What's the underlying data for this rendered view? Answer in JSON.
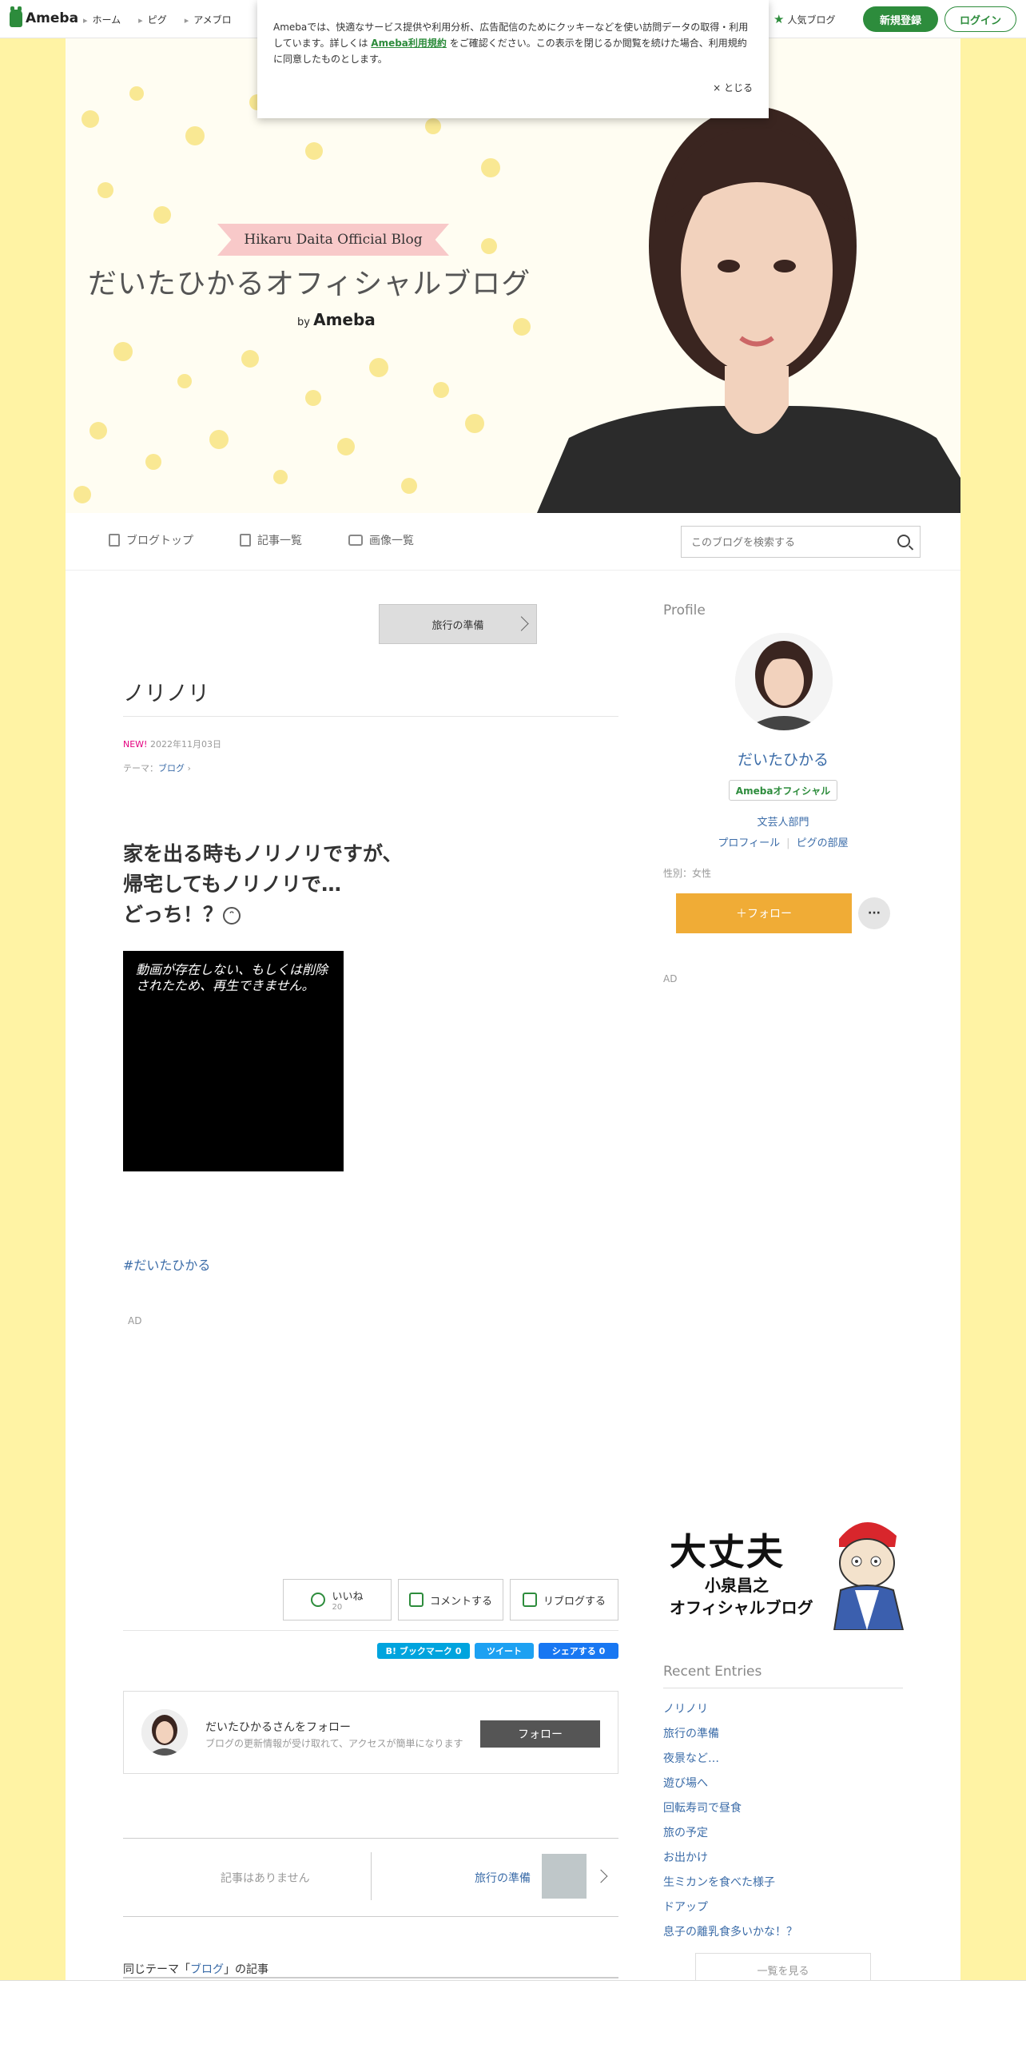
{
  "topbar": {
    "logo": "Ameba",
    "nav": [
      "ホーム",
      "ピグ",
      "アメブロ"
    ],
    "popular": "人気ブログ",
    "register": "新規登録",
    "login": "ログイン"
  },
  "cookie": {
    "text1": "Amebaでは、快適なサービス提供や利用分析、広告配信のためにクッキーなどを使い訪問データの取得・利用しています。詳しくは",
    "link": "Ameba利用規約",
    "text2": "をご確認ください。この表示を閉じるか閲覧を続けた場合、利用規約に同意したものとします。",
    "close": "× とじる"
  },
  "header": {
    "ribbon": "Hikaru Daita Official Blog",
    "title": "だいたひかるオフィシャルブログ",
    "by": "by",
    "ameba": "Ameba"
  },
  "blognav": {
    "items": [
      "ブログトップ",
      "記事一覧",
      "画像一覧"
    ],
    "search_placeholder": "このブログを検索する"
  },
  "article": {
    "prev_theme": "旅行の準備",
    "title": "ノリノリ",
    "new": "NEW!",
    "date": "2022年11月03日",
    "theme_label": "テーマ：",
    "theme": "ブログ",
    "lines": [
      "家を出る時もノリノリですが、",
      "帰宅してもノリノリで…",
      "どっち！？"
    ],
    "video_msg": "動画が存在しない、もしくは削除されたため、再生できません。",
    "hashtag": "#だいたひかる",
    "ad": "AD",
    "like": "いいね",
    "like_count": "20",
    "comment": "コメントする",
    "reblog": "リブログする",
    "share_hatena": "B! ブックマーク 0",
    "share_tweet": "ツイート",
    "share_fb": "シェアする 0",
    "follow_name": "だいたひかるさんをフォロー",
    "follow_sub": "ブログの更新情報が受け取れて、アクセスが簡単になります",
    "follow_btn": "フォロー",
    "no_articles": "記事はありません",
    "next_article": "旅行の準備",
    "same_theme_pre": "同じテーマ「",
    "same_theme": "ブログ",
    "same_theme_post": "」の記事"
  },
  "sidebar": {
    "profile_heading": "Profile",
    "name": "だいたひかる",
    "official": "Amebaオフィシャル",
    "category": "文芸人部門",
    "profile_link": "プロフィール",
    "pig_link": "ピグの部屋",
    "gender": "性別：女性",
    "follow": "＋フォロー",
    "more": "···",
    "ad": "AD",
    "banner_line1": "大丈夫",
    "banner_line2": "小泉昌之",
    "banner_line3": "オフィシャルブログ",
    "recent_heading": "Recent Entries",
    "recent": [
      "ノリノリ",
      "旅行の準備",
      "夜景など…",
      "遊び場へ",
      "回転寿司で昼食",
      "旅の予定",
      "お出かけ",
      "生ミカンを食べた様子",
      "ドアップ",
      "息子の離乳食多いかな！？"
    ],
    "see_all": "一覧を見る"
  },
  "colors": {
    "page_bg": "#fff3a4",
    "ameba_green": "#2d8c3c",
    "link_blue": "#3b6ca8",
    "follow_orange": "#f0ac36"
  }
}
